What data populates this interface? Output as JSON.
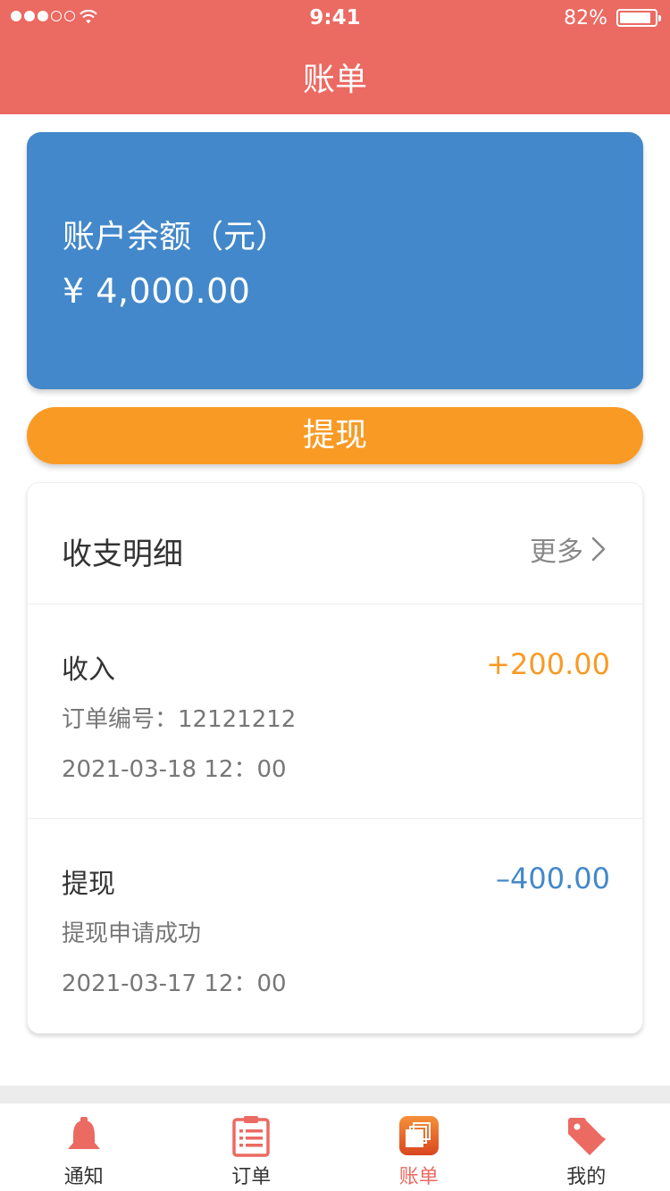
{
  "status_bar": {
    "time": "9:41",
    "battery": "82%"
  },
  "header": {
    "title": "账单"
  },
  "balance_card": {
    "label": "账户余额（元）",
    "amount": "¥ 4,000.00"
  },
  "withdraw_button": {
    "label": "提现"
  },
  "details": {
    "title": "收支明细",
    "more_label": "更多",
    "records": [
      {
        "kind": "收入",
        "amount": "+200.00",
        "sub": "订单编号：12121212",
        "date": "2021-03-18  12：00"
      },
      {
        "kind": "提现",
        "amount": "–400.00",
        "sub": "提现申请成功",
        "date": "2021-03-17  12：00"
      }
    ]
  },
  "tabs": [
    {
      "label": "通知",
      "icon": "bell-icon"
    },
    {
      "label": "订单",
      "icon": "clipboard-icon"
    },
    {
      "label": "账单",
      "icon": "bill-icon",
      "active": true
    },
    {
      "label": "我的",
      "icon": "tag-icon"
    }
  ],
  "colors": {
    "primary": "#EB6A62",
    "balance_bg": "#4388CA",
    "accent_orange": "#F99A24",
    "income": "#F99A24",
    "expense": "#4388CA"
  }
}
